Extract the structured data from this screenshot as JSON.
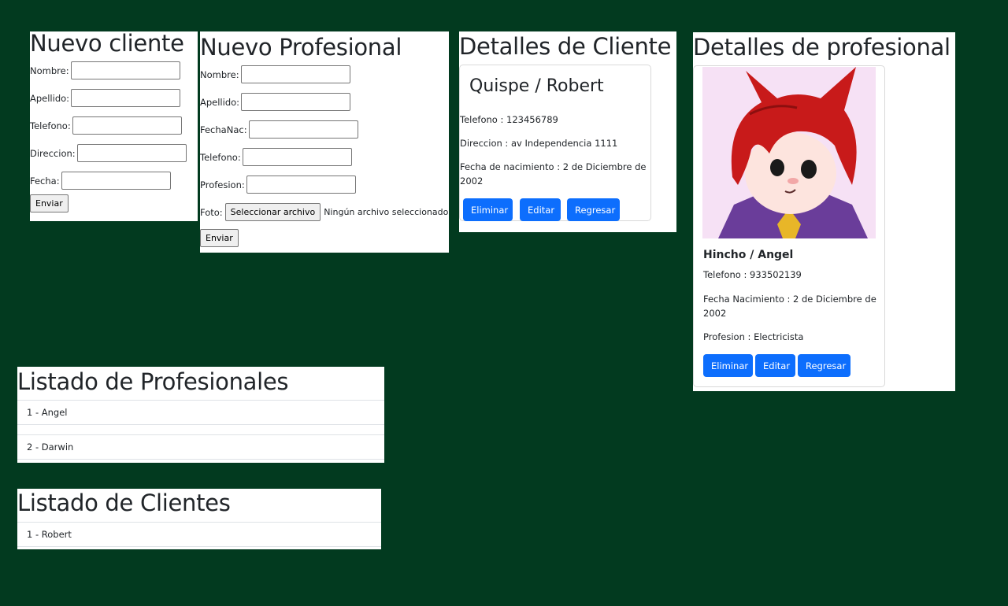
{
  "nuevo_cliente": {
    "title": "Nuevo cliente",
    "fields": [
      {
        "label": "Nombre:",
        "value": ""
      },
      {
        "label": "Apellido:",
        "value": ""
      },
      {
        "label": "Telefono:",
        "value": ""
      },
      {
        "label": "Direccion:",
        "value": ""
      },
      {
        "label": "Fecha:",
        "value": ""
      }
    ],
    "submit_label": "Enviar"
  },
  "nuevo_profesional": {
    "title": "Nuevo Profesional",
    "fields": [
      {
        "label": "Nombre:",
        "value": ""
      },
      {
        "label": "Apellido:",
        "value": ""
      },
      {
        "label": "FechaNac:",
        "value": ""
      },
      {
        "label": "Telefono:",
        "value": ""
      },
      {
        "label": "Profesion:",
        "value": ""
      }
    ],
    "foto_label": "Foto:",
    "file_button_label": "Seleccionar archivo",
    "file_status": "Ningún archivo seleccionado",
    "submit_label": "Enviar"
  },
  "detalles_cliente": {
    "title": "Detalles de Cliente",
    "name": "Quispe / Robert",
    "telefono": "Telefono : 123456789",
    "direccion": "Direccion : av Independencia 1111",
    "fecha_line1": "Fecha de nacimiento : 2 de Diciembre de",
    "fecha_line2": "2002",
    "buttons": {
      "delete": "Eliminar",
      "edit": "Editar",
      "back": "Regresar"
    }
  },
  "detalles_profesional": {
    "title": "Detalles de profesional",
    "name": "Hincho / Angel",
    "telefono": "Telefono : 933502139",
    "fecha_line1": "Fecha Nacimiento : 2 de Diciembre de",
    "fecha_line2": "2002",
    "profesion": "Profesion : Electricista",
    "buttons": {
      "delete": "Eliminar",
      "edit": "Editar",
      "back": "Regresar"
    }
  },
  "listado_profesionales": {
    "title": "Listado de Profesionales",
    "items": [
      "1 - Angel",
      "2 - Darwin"
    ]
  },
  "listado_clientes": {
    "title": "Listado de Clientes",
    "items": [
      "1 - Robert"
    ]
  },
  "colors": {
    "background": "#023a1f",
    "primary": "#0d6efd",
    "panel": "#ffffff"
  }
}
